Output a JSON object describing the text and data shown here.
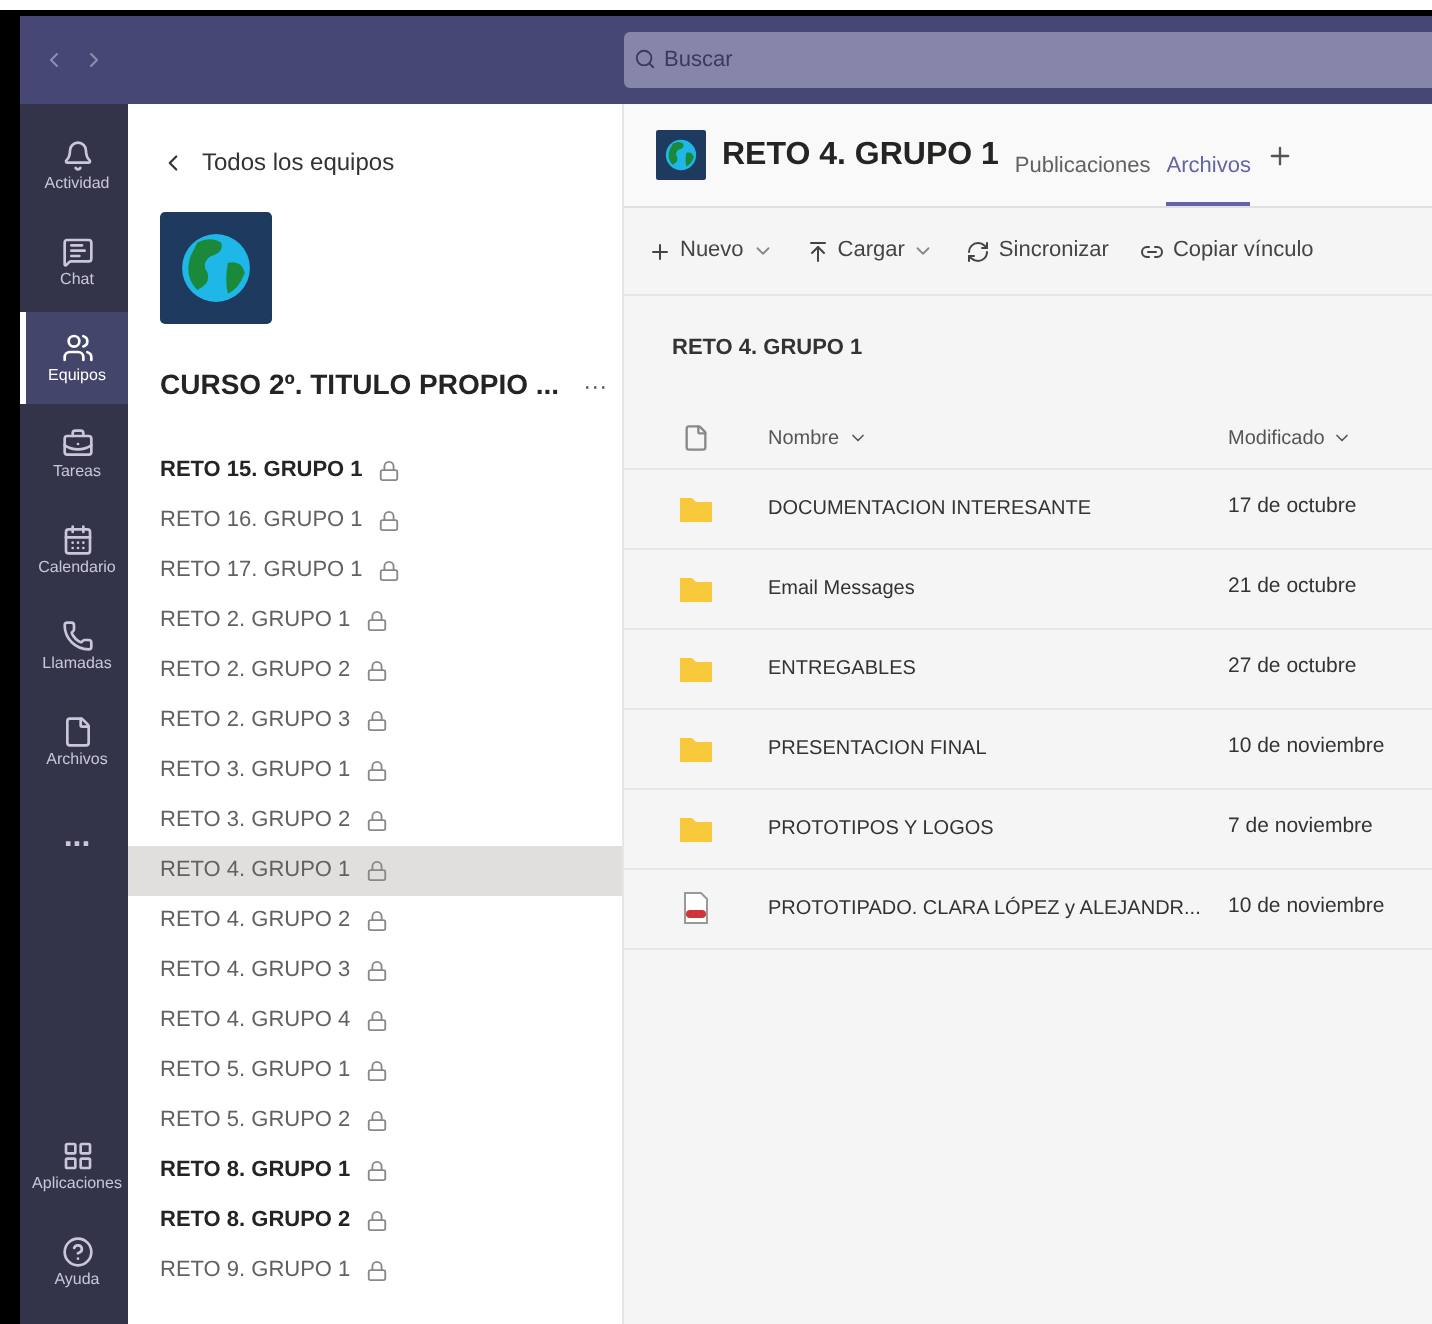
{
  "top_bar": {
    "search": {
      "placeholder": "Buscar"
    }
  },
  "rail": [
    {
      "label": "Actividad",
      "selected": false
    },
    {
      "label": "Chat",
      "selected": false
    },
    {
      "label": "Equipos",
      "selected": true
    },
    {
      "label": "Tareas",
      "selected": false
    },
    {
      "label": "Calendario",
      "selected": false
    },
    {
      "label": "Llamadas",
      "selected": false
    },
    {
      "label": "Archivos",
      "selected": false
    },
    {
      "label": "...",
      "selected": false
    }
  ],
  "rail_bottom": [
    {
      "label": "Aplicaciones",
      "selected": false
    },
    {
      "label": "Ayuda",
      "selected": false
    }
  ],
  "team_panel": {
    "back_link": "Todos los equipos",
    "team_name": "CURSO 2º. TITULO PROPIO ...",
    "more": "···",
    "channels": [
      {
        "name": "RETO 15. GRUPO 1",
        "unread": true,
        "selected": false
      },
      {
        "name": "RETO 16. GRUPO 1",
        "unread": false,
        "selected": false
      },
      {
        "name": "RETO 17. GRUPO 1",
        "unread": false,
        "selected": false
      },
      {
        "name": "RETO 2. GRUPO 1",
        "unread": false,
        "selected": false
      },
      {
        "name": "RETO 2. GRUPO 2",
        "unread": false,
        "selected": false
      },
      {
        "name": "RETO 2. GRUPO 3",
        "unread": false,
        "selected": false
      },
      {
        "name": "RETO 3. GRUPO 1",
        "unread": false,
        "selected": false
      },
      {
        "name": "RETO 3. GRUPO 2",
        "unread": false,
        "selected": false
      },
      {
        "name": "RETO 4. GRUPO 1",
        "unread": false,
        "selected": true
      },
      {
        "name": "RETO 4. GRUPO 2",
        "unread": false,
        "selected": false
      },
      {
        "name": "RETO 4. GRUPO 3",
        "unread": false,
        "selected": false
      },
      {
        "name": "RETO 4. GRUPO 4",
        "unread": false,
        "selected": false
      },
      {
        "name": "RETO 5. GRUPO 1",
        "unread": false,
        "selected": false
      },
      {
        "name": "RETO 5. GRUPO 2",
        "unread": false,
        "selected": false
      },
      {
        "name": "RETO 8. GRUPO 1",
        "unread": true,
        "selected": false
      },
      {
        "name": "RETO 8. GRUPO 2",
        "unread": true,
        "selected": false
      },
      {
        "name": "RETO 9. GRUPO 1",
        "unread": false,
        "selected": false
      }
    ]
  },
  "channel_header": {
    "title": "RETO 4. GRUPO 1",
    "tabs": [
      {
        "label": "Publicaciones",
        "selected": false
      },
      {
        "label": "Archivos",
        "selected": true
      }
    ]
  },
  "toolbar": [
    {
      "label": "Nuevo",
      "dropdown": true
    },
    {
      "label": "Cargar",
      "dropdown": true
    },
    {
      "label": "Sincronizar",
      "dropdown": false
    },
    {
      "label": "Copiar vínculo",
      "dropdown": false
    }
  ],
  "breadcrumb": "RETO 4. GRUPO 1",
  "table": {
    "columns": [
      "Nombre",
      "Modificado"
    ],
    "rows": [
      {
        "kind": "folder",
        "name": "DOCUMENTACION INTERESANTE",
        "modified": "17 de octubre"
      },
      {
        "kind": "folder",
        "name": "Email Messages",
        "modified": "21 de octubre"
      },
      {
        "kind": "folder",
        "name": "ENTREGABLES",
        "modified": "27 de octubre"
      },
      {
        "kind": "folder",
        "name": "PRESENTACION FINAL",
        "modified": "10 de noviembre"
      },
      {
        "kind": "folder",
        "name": "PROTOTIPOS Y LOGOS",
        "modified": "7 de noviembre"
      },
      {
        "kind": "pdf",
        "name": "PROTOTIPADO. CLARA LÓPEZ y ALEJANDR...",
        "modified": "10 de noviembre"
      }
    ]
  }
}
